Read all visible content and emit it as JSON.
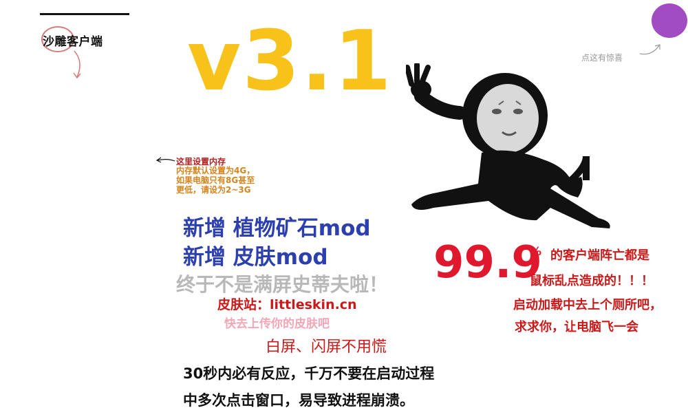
{
  "app": {
    "name": "沙雕客户端",
    "version": "v3.1"
  },
  "memory": {
    "title": "这里设置内存",
    "lines": [
      "内存默认设置为4G，",
      "如果电脑只有8G甚至",
      "更低，请设为2~3G"
    ]
  },
  "news": {
    "mod1": "新增 植物矿石mod",
    "mod2": "新增 皮肤mod",
    "steve": "终于不是满屏史蒂夫啦！",
    "skin_site": "皮肤站：littleskin.cn",
    "skin_upload": "快去上传你的皮肤吧",
    "whitescreen": "白屏、闪屏不用慌",
    "tip1": "30秒内必有反应，千万不要在启动过程",
    "tip2": "中多次点击窗口，易导致进程崩溃。"
  },
  "surprise": {
    "text": "点这有惊喜"
  },
  "crash": {
    "percent": "99.9",
    "percent_sign": "%",
    "line1": "的客户端阵亡都是",
    "line2": "鼠标乱点造成的！！！",
    "line3": "启动加载中去上个厕所吧，",
    "line4": "求求你，让电脑飞一会"
  },
  "colors": {
    "version": "#f7c21a",
    "mod": "#2c3fae",
    "warning_red": "#e0182d",
    "purple": "#a24cc3"
  }
}
